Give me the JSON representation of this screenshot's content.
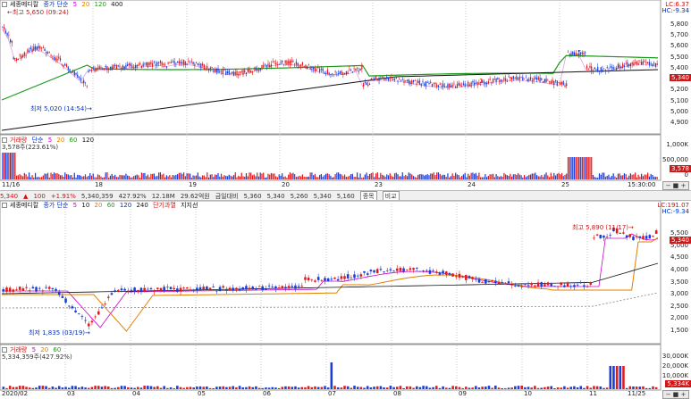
{
  "top_chart": {
    "legend": {
      "stock_name": "세종메디칼",
      "ma_label": "종가 단순",
      "periods": [
        "5",
        "20",
        "120",
        "400"
      ],
      "high_label": "최고 5,650 (09:24)"
    },
    "axis_top": {
      "lc": "LC:6.37",
      "hc": "HC:-9.34"
    },
    "y_ticks": [
      "5,800",
      "5,700",
      "5,600",
      "5,500",
      "5,400",
      "5,300",
      "5,200",
      "5,100",
      "5,000",
      "4,900"
    ],
    "current_price": "5,340",
    "low_annotation": "최저 5,020 (14:54)",
    "markers": [
      "5",
      "1",
      "2"
    ],
    "volume_legend": {
      "label": "거래량",
      "ma_label": "단순",
      "periods": [
        "5",
        "20",
        "60",
        "120"
      ],
      "value": "3,578주(223.61%)"
    },
    "volume_ticks": [
      "1,000K",
      "500,000",
      "0"
    ],
    "volume_current": "3,578",
    "x_labels": [
      "11/16",
      "18",
      "19",
      "20",
      "23",
      "24",
      "25",
      "15:30:00"
    ],
    "colors": {
      "up": "#e01b1b",
      "down": "#1b3fd6",
      "ma5": "#e0a0e0",
      "ma20": "#1a9a1a",
      "ma120": "#1a9a1a",
      "ma400": "#111111"
    }
  },
  "toolbar": {
    "items": [
      "5,340",
      "▲",
      "100",
      "+1.91%",
      "5,340,359",
      "427.92%",
      "12.18M",
      "29.62억원",
      "금일대비",
      "5,360",
      "5,340",
      "5,260",
      "5,340",
      "5,160",
      "종목",
      "비교"
    ]
  },
  "bottom_chart": {
    "legend": {
      "stock_name": "세종메디칼",
      "ma_label": "종가 단순",
      "periods": [
        "5",
        "10",
        "20",
        "60",
        "120",
        "240"
      ],
      "extra": [
        "단기과열",
        "지지선"
      ]
    },
    "axis_top": {
      "lc": "LC:191.07",
      "hc": "HC:-9.34"
    },
    "y_ticks": [
      "5,500",
      "5,000",
      "4,500",
      "4,000",
      "3,500",
      "3,000",
      "2,500",
      "2,000",
      "1,500"
    ],
    "current_price": "5,340",
    "high_annotation": "최고 5,890 (11/17)",
    "low_annotation": "최저 1,835 (03/19)",
    "volume_legend": {
      "label": "거래량",
      "periods": [
        "5",
        "20",
        "60"
      ],
      "value": "5,334,359주(427.92%)"
    },
    "volume_ticks": [
      "30,000K",
      "20,000K",
      "10,000K",
      "0"
    ],
    "volume_current": "5,334K",
    "x_labels": [
      "2020/02",
      "03",
      "04",
      "05",
      "06",
      "07",
      "08",
      "09",
      "10",
      "11",
      "11/25"
    ],
    "colors": {
      "up": "#e01b1b",
      "down": "#1b3fd6"
    }
  }
}
